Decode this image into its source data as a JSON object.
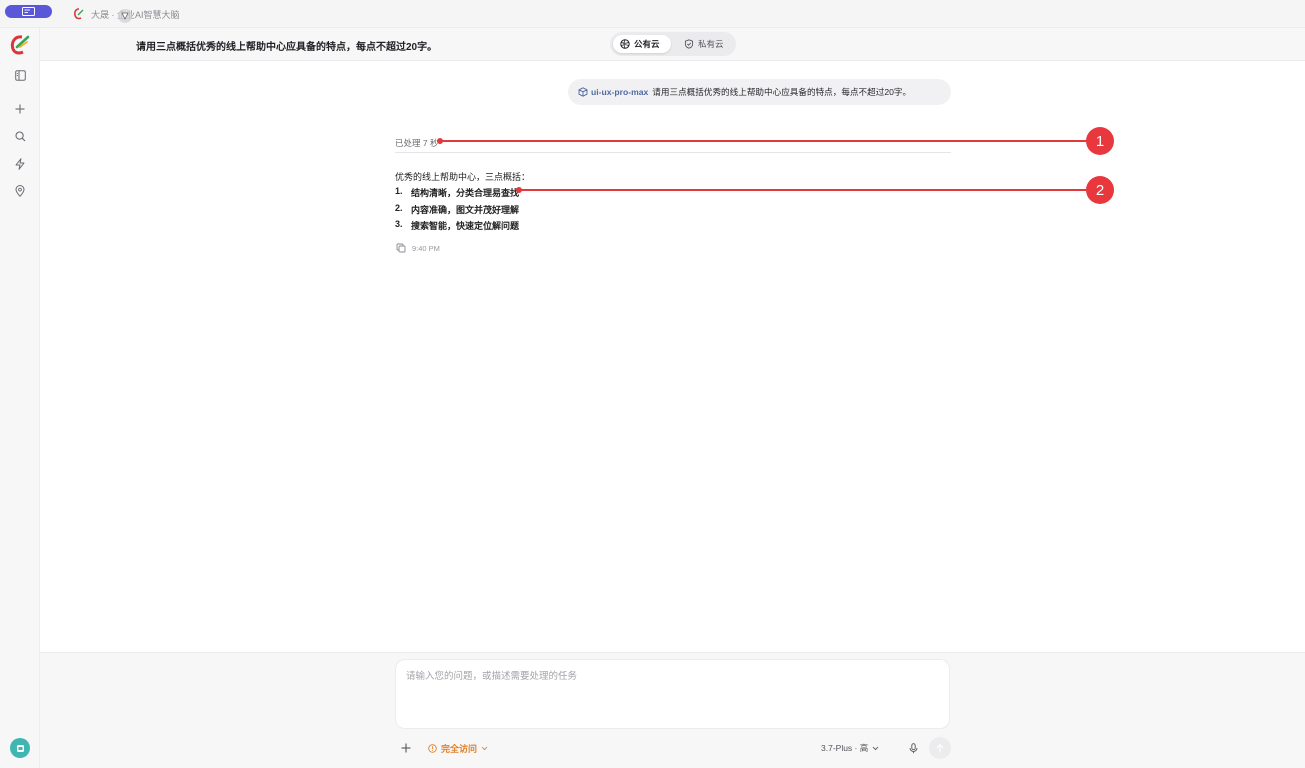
{
  "window": {
    "app_title": "大晟 · 企业AI智慧大脑"
  },
  "header": {
    "conversation_title": "请用三点概括优秀的线上帮助中心应具备的特点，每点不超过20字。",
    "cloud_options": [
      {
        "label": "公有云",
        "active": true,
        "icon": "globe-icon"
      },
      {
        "label": "私有云",
        "active": false,
        "icon": "shield-icon"
      }
    ]
  },
  "sidebar": {
    "items": [
      {
        "name": "panel-toggle",
        "icon": "sidebar-panel-icon"
      },
      {
        "name": "new-chat",
        "icon": "plus-icon"
      },
      {
        "name": "search",
        "icon": "search-icon"
      },
      {
        "name": "quick-actions",
        "icon": "lightning-icon"
      },
      {
        "name": "location",
        "icon": "location-pin-icon"
      }
    ]
  },
  "chat": {
    "user_message": {
      "skill": "ui-ux-pro-max",
      "text": "请用三点概括优秀的线上帮助中心应具备的特点，每点不超过20字。"
    },
    "assistant": {
      "processed_label": "已处理 7 秒",
      "intro": "优秀的线上帮助中心，三点概括：",
      "points": [
        {
          "num": "1.",
          "text": "结构清晰，分类合理易查找"
        },
        {
          "num": "2.",
          "text": "内容准确，图文并茂好理解"
        },
        {
          "num": "3.",
          "text": "搜索智能，快速定位解问题"
        }
      ],
      "time": "9:40 PM"
    }
  },
  "annotations": [
    {
      "label": "1"
    },
    {
      "label": "2"
    }
  ],
  "composer": {
    "placeholder": "请输入您的问题，或描述需要处理的任务",
    "access_label": "完全访问",
    "model_label": "3.7-Plus · 高"
  },
  "colors": {
    "accent_purple": "#5b57d9",
    "annotation_red": "#e8383d",
    "access_orange": "#e0812c",
    "skill_blue": "#4f6aa3"
  }
}
